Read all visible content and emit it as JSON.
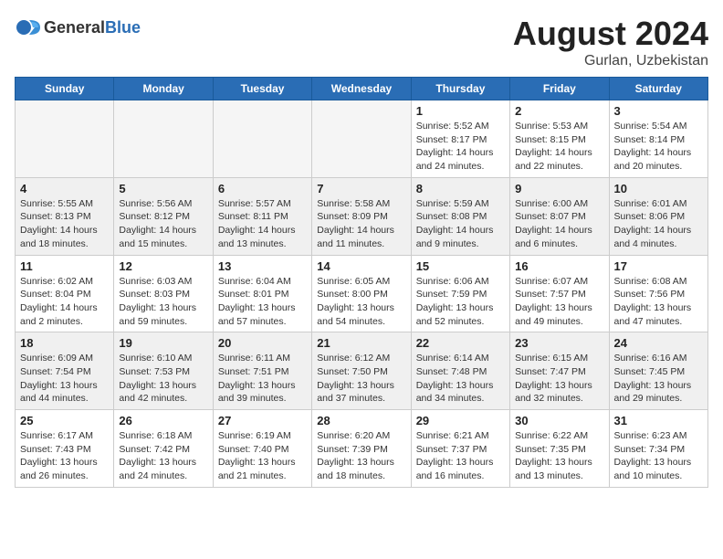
{
  "header": {
    "logo_general": "General",
    "logo_blue": "Blue",
    "title": "August 2024",
    "location": "Gurlan, Uzbekistan"
  },
  "days_of_week": [
    "Sunday",
    "Monday",
    "Tuesday",
    "Wednesday",
    "Thursday",
    "Friday",
    "Saturday"
  ],
  "weeks": [
    [
      {
        "day": "",
        "empty": true
      },
      {
        "day": "",
        "empty": true
      },
      {
        "day": "",
        "empty": true
      },
      {
        "day": "",
        "empty": true
      },
      {
        "day": "1",
        "sunrise": "5:52 AM",
        "sunset": "8:17 PM",
        "daylight": "14 hours and 24 minutes."
      },
      {
        "day": "2",
        "sunrise": "5:53 AM",
        "sunset": "8:15 PM",
        "daylight": "14 hours and 22 minutes."
      },
      {
        "day": "3",
        "sunrise": "5:54 AM",
        "sunset": "8:14 PM",
        "daylight": "14 hours and 20 minutes."
      }
    ],
    [
      {
        "day": "4",
        "sunrise": "5:55 AM",
        "sunset": "8:13 PM",
        "daylight": "14 hours and 18 minutes."
      },
      {
        "day": "5",
        "sunrise": "5:56 AM",
        "sunset": "8:12 PM",
        "daylight": "14 hours and 15 minutes."
      },
      {
        "day": "6",
        "sunrise": "5:57 AM",
        "sunset": "8:11 PM",
        "daylight": "14 hours and 13 minutes."
      },
      {
        "day": "7",
        "sunrise": "5:58 AM",
        "sunset": "8:09 PM",
        "daylight": "14 hours and 11 minutes."
      },
      {
        "day": "8",
        "sunrise": "5:59 AM",
        "sunset": "8:08 PM",
        "daylight": "14 hours and 9 minutes."
      },
      {
        "day": "9",
        "sunrise": "6:00 AM",
        "sunset": "8:07 PM",
        "daylight": "14 hours and 6 minutes."
      },
      {
        "day": "10",
        "sunrise": "6:01 AM",
        "sunset": "8:06 PM",
        "daylight": "14 hours and 4 minutes."
      }
    ],
    [
      {
        "day": "11",
        "sunrise": "6:02 AM",
        "sunset": "8:04 PM",
        "daylight": "14 hours and 2 minutes."
      },
      {
        "day": "12",
        "sunrise": "6:03 AM",
        "sunset": "8:03 PM",
        "daylight": "13 hours and 59 minutes."
      },
      {
        "day": "13",
        "sunrise": "6:04 AM",
        "sunset": "8:01 PM",
        "daylight": "13 hours and 57 minutes."
      },
      {
        "day": "14",
        "sunrise": "6:05 AM",
        "sunset": "8:00 PM",
        "daylight": "13 hours and 54 minutes."
      },
      {
        "day": "15",
        "sunrise": "6:06 AM",
        "sunset": "7:59 PM",
        "daylight": "13 hours and 52 minutes."
      },
      {
        "day": "16",
        "sunrise": "6:07 AM",
        "sunset": "7:57 PM",
        "daylight": "13 hours and 49 minutes."
      },
      {
        "day": "17",
        "sunrise": "6:08 AM",
        "sunset": "7:56 PM",
        "daylight": "13 hours and 47 minutes."
      }
    ],
    [
      {
        "day": "18",
        "sunrise": "6:09 AM",
        "sunset": "7:54 PM",
        "daylight": "13 hours and 44 minutes."
      },
      {
        "day": "19",
        "sunrise": "6:10 AM",
        "sunset": "7:53 PM",
        "daylight": "13 hours and 42 minutes."
      },
      {
        "day": "20",
        "sunrise": "6:11 AM",
        "sunset": "7:51 PM",
        "daylight": "13 hours and 39 minutes."
      },
      {
        "day": "21",
        "sunrise": "6:12 AM",
        "sunset": "7:50 PM",
        "daylight": "13 hours and 37 minutes."
      },
      {
        "day": "22",
        "sunrise": "6:14 AM",
        "sunset": "7:48 PM",
        "daylight": "13 hours and 34 minutes."
      },
      {
        "day": "23",
        "sunrise": "6:15 AM",
        "sunset": "7:47 PM",
        "daylight": "13 hours and 32 minutes."
      },
      {
        "day": "24",
        "sunrise": "6:16 AM",
        "sunset": "7:45 PM",
        "daylight": "13 hours and 29 minutes."
      }
    ],
    [
      {
        "day": "25",
        "sunrise": "6:17 AM",
        "sunset": "7:43 PM",
        "daylight": "13 hours and 26 minutes."
      },
      {
        "day": "26",
        "sunrise": "6:18 AM",
        "sunset": "7:42 PM",
        "daylight": "13 hours and 24 minutes."
      },
      {
        "day": "27",
        "sunrise": "6:19 AM",
        "sunset": "7:40 PM",
        "daylight": "13 hours and 21 minutes."
      },
      {
        "day": "28",
        "sunrise": "6:20 AM",
        "sunset": "7:39 PM",
        "daylight": "13 hours and 18 minutes."
      },
      {
        "day": "29",
        "sunrise": "6:21 AM",
        "sunset": "7:37 PM",
        "daylight": "13 hours and 16 minutes."
      },
      {
        "day": "30",
        "sunrise": "6:22 AM",
        "sunset": "7:35 PM",
        "daylight": "13 hours and 13 minutes."
      },
      {
        "day": "31",
        "sunrise": "6:23 AM",
        "sunset": "7:34 PM",
        "daylight": "13 hours and 10 minutes."
      }
    ]
  ],
  "labels": {
    "sunrise": "Sunrise:",
    "sunset": "Sunset:",
    "daylight": "Daylight hours"
  }
}
